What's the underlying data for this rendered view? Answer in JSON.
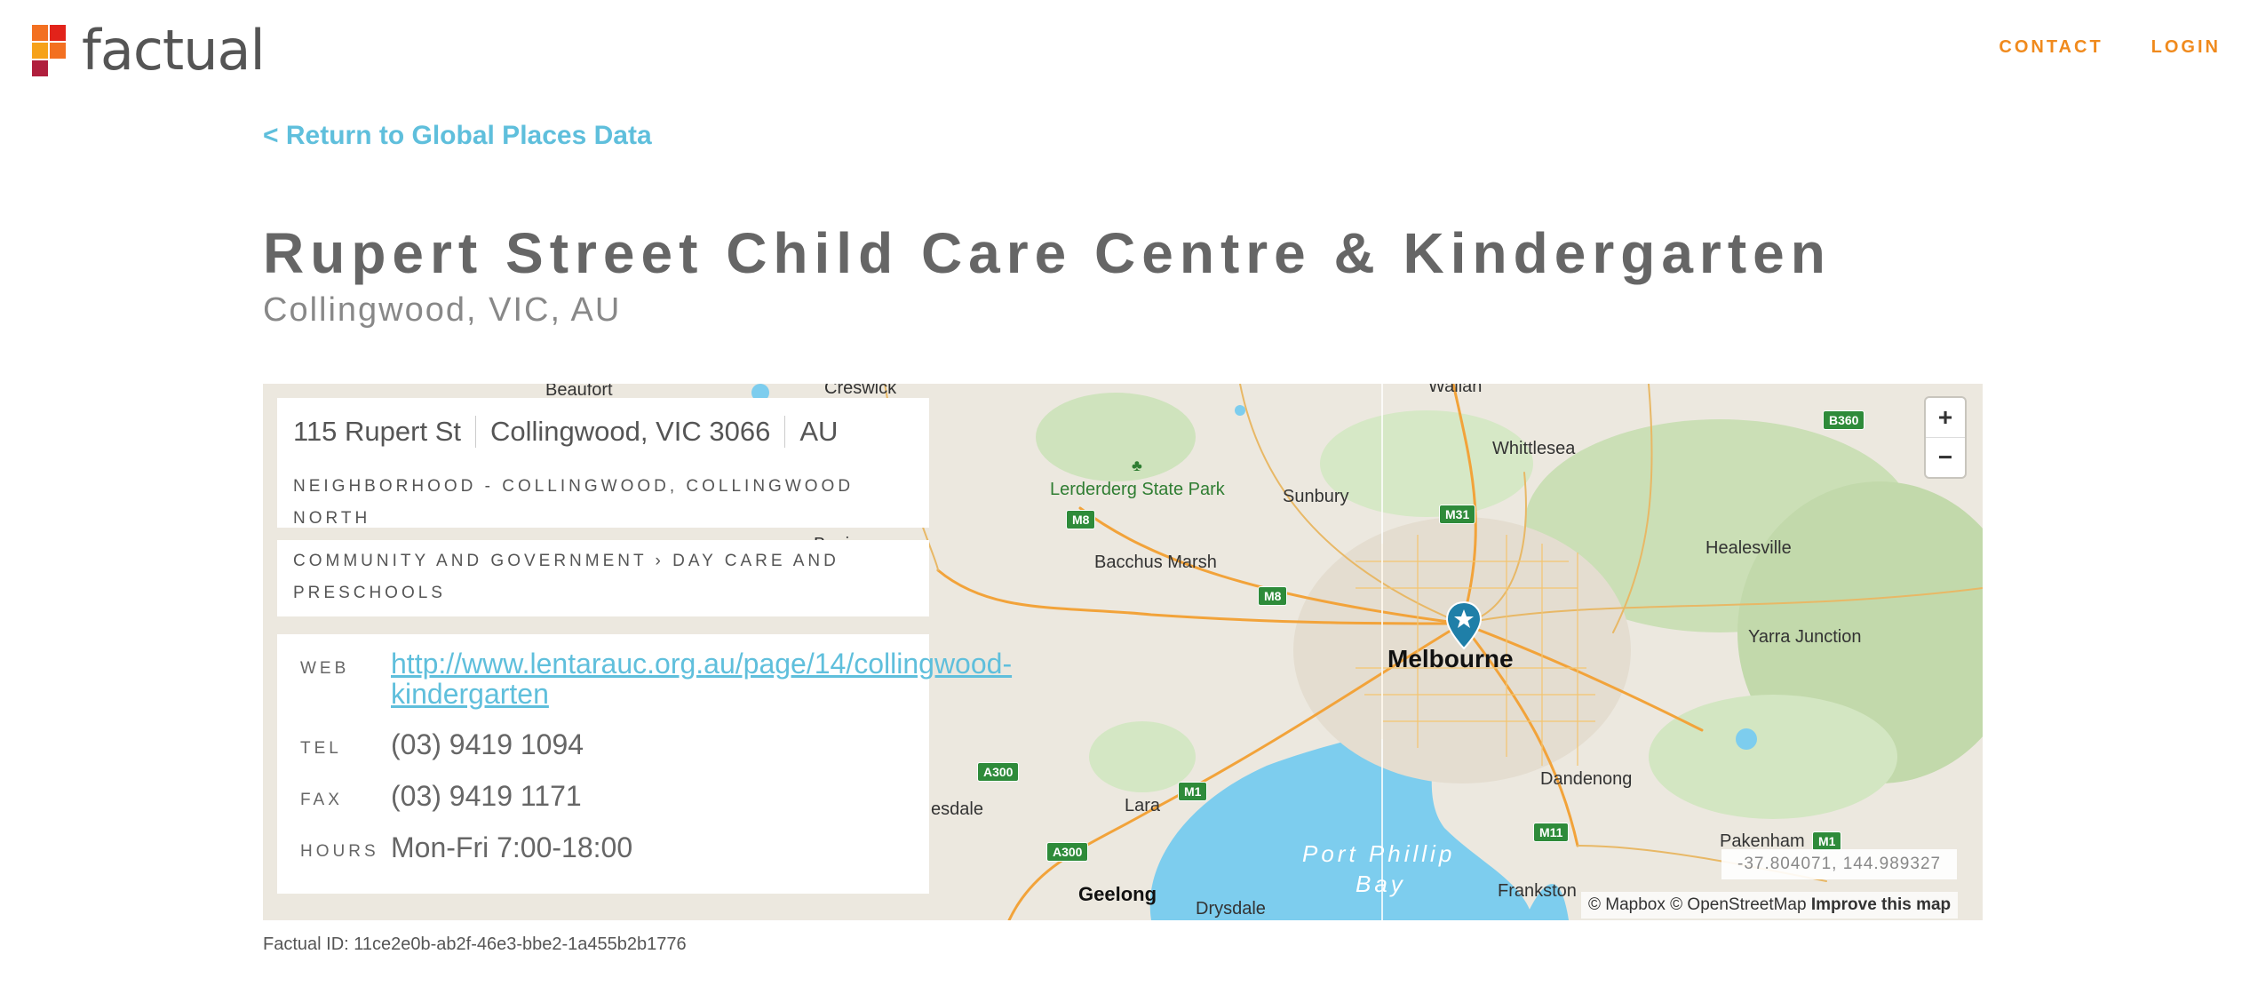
{
  "brand": {
    "name": "factual",
    "colors": [
      "#f37021",
      "#f6a21a",
      "#e2231a",
      "#b01f3d"
    ]
  },
  "nav": {
    "contact": "CONTACT",
    "login": "LOGIN",
    "color": "#f08a1d"
  },
  "back_link": "< Return to Global Places Data",
  "place": {
    "name": "Rupert Street Child Care Centre & Kindergarten",
    "locality": "Collingwood, VIC, AU",
    "address": {
      "street": "115 Rupert St",
      "city_line": "Collingwood, VIC 3066",
      "country": "AU"
    },
    "neighborhood": "NEIGHBORHOOD - COLLINGWOOD, COLLINGWOOD NORTH",
    "category": "COMMUNITY AND GOVERNMENT › DAY CARE AND PRESCHOOLS",
    "contact": [
      {
        "label": "WEB",
        "value": "http://www.lentarauc.org.au/page/14/collingwood-kindergarten"
      },
      {
        "label": "TEL",
        "value": "(03) 9419 1094"
      },
      {
        "label": "FAX",
        "value": "(03) 9419 1171"
      },
      {
        "label": "HOURS",
        "value": "Mon-Fri 7:00-18:00"
      }
    ]
  },
  "map": {
    "labels": {
      "beaufort": "Beaufort",
      "creswick": "Creswick",
      "wallan": "Wallan",
      "whittlesea": "Whittlesea",
      "lerderderg": "Lerderderg State Park",
      "sunbury": "Sunbury",
      "buninyong": "Buninyong",
      "bacchus_marsh": "Bacchus Marsh",
      "healesville": "Healesville",
      "yarra_junction": "Yarra Junction",
      "melbourne": "Melbourne",
      "dandenong": "Dandenong",
      "lara": "Lara",
      "esdale": "esdale",
      "port_phillip": "Port Phillip",
      "bay": "Bay",
      "pakenham": "Pakenham",
      "frankston": "Frankston",
      "geelong": "Geelong",
      "drysdale": "Drysdale"
    },
    "shields": {
      "b360": "B360",
      "m8a": "M8",
      "m31": "M31",
      "m8b": "M8",
      "a300a": "A300",
      "m1a": "M1",
      "a300b": "A300",
      "m11": "M11",
      "m1b": "M1"
    },
    "zoom_in": "+",
    "zoom_out": "−",
    "coordinates": "-37.804071, 144.989327",
    "attribution": "© Mapbox © OpenStreetMap",
    "improve": "Improve this map",
    "water_color": "#7dcdee",
    "pin_color": "#1f7fa8"
  },
  "factual_id": "Factual ID: 11ce2e0b-ab2f-46e3-bbe2-1a455b2b1776"
}
